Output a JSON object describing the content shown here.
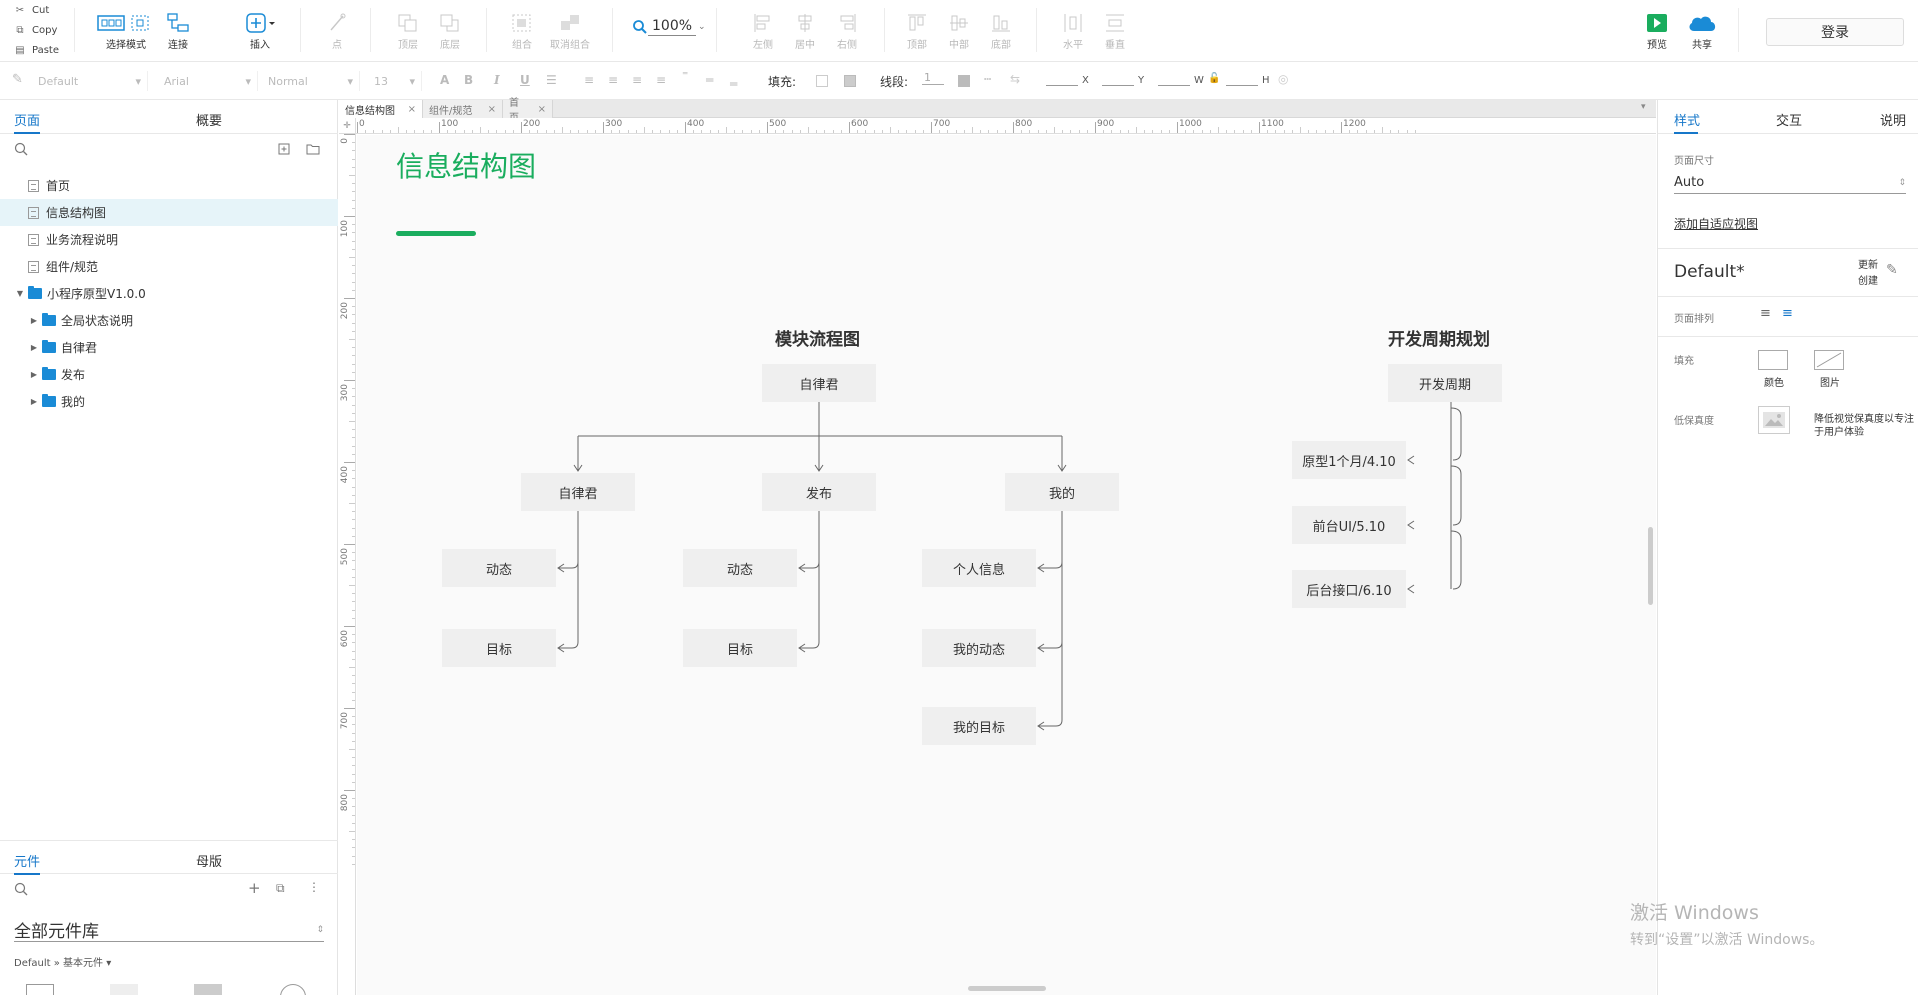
{
  "clipboard": {
    "cut": "Cut",
    "copy": "Copy",
    "paste": "Paste"
  },
  "toolbar": {
    "select_mode": "选择模式",
    "connect": "连接",
    "insert": "插入",
    "point": "点",
    "top_layer": "顶层",
    "bottom_layer": "底层",
    "group": "组合",
    "ungroup": "取消组合",
    "zoom": "100%",
    "align_left": "左侧",
    "align_center": "居中",
    "align_right": "右侧",
    "align_top": "顶部",
    "align_middle": "中部",
    "align_bottom": "底部",
    "distribute_h": "水平",
    "distribute_v": "垂直",
    "preview": "预览",
    "share": "共享",
    "login": "登录",
    "preview_color": "#1aad5e",
    "share_color": "#1a8bd6"
  },
  "format": {
    "style": "Default",
    "font": "Arial",
    "weight": "Normal",
    "size": "13",
    "fill_label": "填充:",
    "stroke_label": "线段:",
    "stroke_value": "1",
    "x": "X",
    "y": "Y",
    "w": "W",
    "h": "H"
  },
  "left_panel": {
    "tabs": [
      "页面",
      "概要"
    ],
    "pages": [
      {
        "label": "首页",
        "type": "page",
        "depth": 0
      },
      {
        "label": "信息结构图",
        "type": "page",
        "depth": 0,
        "selected": true
      },
      {
        "label": "业务流程说明",
        "type": "page",
        "depth": 0
      },
      {
        "label": "组件/规范",
        "type": "page",
        "depth": 0
      },
      {
        "label": "小程序原型V1.0.0",
        "type": "folder",
        "depth": 0,
        "expanded": true
      },
      {
        "label": "全局状态说明",
        "type": "folder",
        "depth": 1
      },
      {
        "label": "自律君",
        "type": "folder",
        "depth": 1
      },
      {
        "label": "发布",
        "type": "folder",
        "depth": 1
      },
      {
        "label": "我的",
        "type": "folder",
        "depth": 1
      }
    ],
    "bottom_tabs": [
      "元件",
      "母版"
    ],
    "library": "全部元件库",
    "library_path": "Default » 基本元件 ▾"
  },
  "doc_tabs": [
    "信息结构图",
    "组件/规范",
    "首页"
  ],
  "ruler": {
    "h": [
      "0",
      "100",
      "200",
      "300",
      "400",
      "500",
      "600",
      "700",
      "800",
      "900",
      "1000",
      "1100",
      "1200"
    ],
    "v": [
      "0",
      "100",
      "200",
      "300",
      "400",
      "500",
      "600",
      "700",
      "800"
    ]
  },
  "canvas": {
    "page_title": "信息结构图",
    "accent": "#1aad5e",
    "module_title": "模块流程图",
    "module_root": "自律君",
    "modules": [
      {
        "label": "自律君",
        "children": [
          "动态",
          "目标"
        ]
      },
      {
        "label": "发布",
        "children": [
          "动态",
          "目标"
        ]
      },
      {
        "label": "我的",
        "children": [
          "个人信息",
          "我的动态",
          "我的目标"
        ]
      }
    ],
    "dev_title": "开发周期规划",
    "dev_root": "开发周期",
    "dev_items": [
      "原型1个月/4.10",
      "前台UI/5.10",
      "后台接口/6.10"
    ]
  },
  "right_panel": {
    "tabs": [
      "样式",
      "交互",
      "说明"
    ],
    "page_size_label": "页面尺寸",
    "page_size": "Auto",
    "add_adaptive": "添加自适应视图",
    "style_name": "Default*",
    "update": "更新",
    "create": "创建",
    "page_align_label": "页面排列",
    "fill_label": "填充",
    "fill_color": "颜色",
    "fill_image": "图片",
    "lowfi_label": "低保真度",
    "lowfi_desc1": "降低视觉保真度以专注",
    "lowfi_desc2": "于用户体验"
  },
  "watermark": {
    "line1": "激活 Windows",
    "line2": "转到“设置”以激活 Windows。"
  }
}
